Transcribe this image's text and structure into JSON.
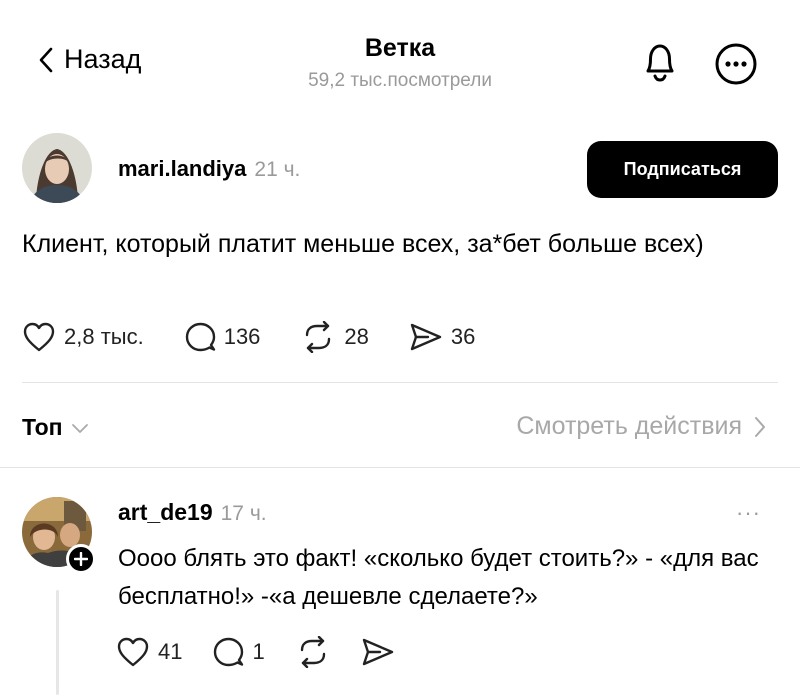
{
  "header": {
    "back_label": "Назад",
    "title": "Ветка",
    "views": "59,2 тыс.посмотрели"
  },
  "post": {
    "author": "mari.landiya",
    "time": "21 ч.",
    "follow_label": "Подписаться",
    "text": "Клиент, который платит меньше всех, за*бет больше всех)",
    "likes": "2,8 тыс.",
    "comments": "136",
    "reposts": "28",
    "shares": "36"
  },
  "sort": {
    "label": "Топ",
    "activity_label": "Смотреть действия"
  },
  "reply": {
    "author": "art_de19",
    "time": "17 ч.",
    "more": "···",
    "text": "Оооо блять это факт! «сколько будет стоить?» - «для вас бесплатно!» -«а дешевле сделаете?»",
    "likes": "41",
    "comments": "1"
  },
  "icons": {
    "back": "chevron-left-icon",
    "bell": "bell-icon",
    "more": "more-circle-icon",
    "like": "heart-icon",
    "comment": "comment-icon",
    "repost": "repost-icon",
    "share": "send-icon",
    "sort": "chevron-down-icon",
    "activity": "chevron-right-icon",
    "follow_plus": "plus-icon"
  },
  "colors": {
    "text": "#000000",
    "muted": "#9a9a9a",
    "follow_bg": "#000000",
    "divider": "#e3e3e3"
  }
}
